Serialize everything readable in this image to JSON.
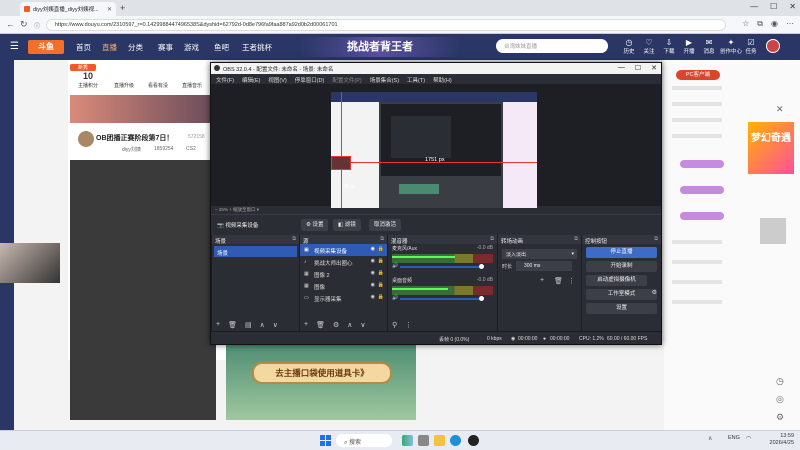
{
  "browser": {
    "tab_title": "diyy刘姨直播_diyy刘姨视...",
    "url": "https://www.douyu.com/2310597_r=0.1429988447496538S&dyshid=62792d-0d8e796fa9faa887a92d0b2d00061701"
  },
  "douyu_header": {
    "logo": "斗鱼",
    "nav": [
      "首页",
      "直播",
      "分类",
      "赛事",
      "游戏",
      "鱼吧",
      "王者挑杯"
    ],
    "event_small": "王者挑杯",
    "banner": "挑战者背王者",
    "search_placeholder": "台湾妹妹直播",
    "icons": [
      "历史",
      "关注",
      "下载",
      "开播",
      "消息",
      "创作中心",
      "任务"
    ]
  },
  "left_stats": {
    "level": "10",
    "level_label": "主播积分",
    "badge_new": "新秀",
    "fans_label": "直播升级",
    "items": [
      "看看有没",
      "直播音乐"
    ]
  },
  "stream": {
    "title": "OB团播正赛阶段第7日！",
    "streamer": "diyy刘姨",
    "fans": "1859254",
    "views": "CS2",
    "count_badge": "572158"
  },
  "ad": {
    "text": "去主播口袋使用道具卡》"
  },
  "right_col": {
    "pc_badge": "PC客户端"
  },
  "promo": {
    "text": "梦幻奇遇"
  },
  "obs": {
    "title": "OBS 32.0.4 - 配置文件: 未命名 - 场景: 未命名",
    "menus": [
      "文件(F)",
      "编辑(E)",
      "视图(V)",
      "停靠窗口(D)",
      "配置文件(P)",
      "场景集合(S)",
      "工具(T)",
      "帮助(H)"
    ],
    "dim_menu_index": 4,
    "preview_label": "1751 px",
    "preview_label2": "38 px",
    "zoom_text": "−   25%   +   缩放至窗口 ▾",
    "source_name": "视频采集设备",
    "toolbar": {
      "settings": "⚙ 设置",
      "filters": "◧ 滤镜",
      "deactivate": "取消激活"
    },
    "scenes_title": "场景",
    "scenes": [
      "场景"
    ],
    "sources_title": "源",
    "sources": [
      {
        "icon": "▣",
        "name": "视频采集设备",
        "selected": true
      },
      {
        "icon": "♪",
        "name": "挑战大师出圈心",
        "selected": false
      },
      {
        "icon": "▦",
        "name": "图像 2",
        "selected": false
      },
      {
        "icon": "▦",
        "name": "图像",
        "selected": false
      },
      {
        "icon": "▭",
        "name": "显示器采集",
        "selected": false
      }
    ],
    "mixer_title": "混音器",
    "mixer": [
      {
        "name": "麦克风/Aux",
        "db": "-0.0 dB",
        "level": 0.62
      },
      {
        "name": "桌面音频",
        "db": "-0.0 dB",
        "level": 0.55
      }
    ],
    "transitions_title": "转场动画",
    "transition_type": "淡入淡出",
    "duration_label": "时长",
    "duration_value": "300 ms",
    "controls_title": "控制按钮",
    "controls": [
      "停止直播",
      "开始录制",
      "启动虚拟摄像机",
      "工作室模式",
      "设置"
    ],
    "status": {
      "dropped": "丢帧 0 (0.0%)",
      "kbps": "0 kbps",
      "live": "00:00:00",
      "rec": "00:00:00",
      "cpu": "CPU: 1.2%",
      "fps": "60.00 / 60.00 FPS"
    }
  },
  "taskbar": {
    "search": "搜索",
    "lang": "ENG",
    "time": "13:59",
    "date": "2026/4/25"
  },
  "colors": {
    "douyu_nav": "#2a3766",
    "obs_bg": "#2b2d34",
    "obs_accent": "#3d6bc6"
  }
}
